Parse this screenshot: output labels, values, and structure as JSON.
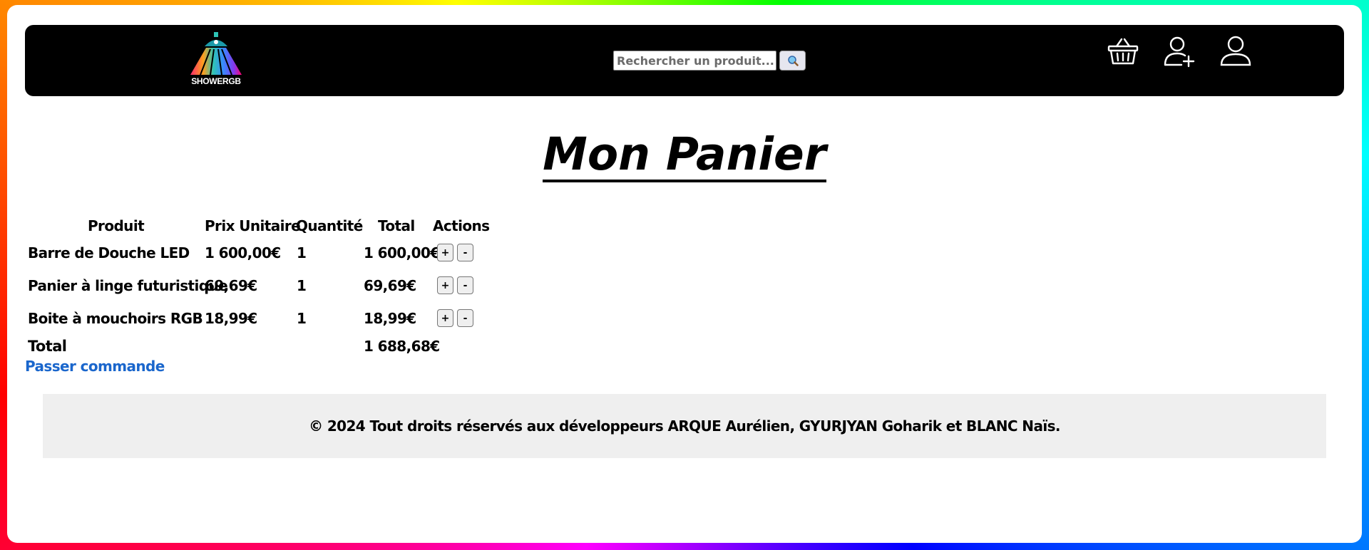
{
  "header": {
    "logo_text": "SHOWERGB",
    "search": {
      "placeholder": "Rechercher un produit..."
    },
    "icons": [
      "search-icon",
      "basket-icon",
      "add-user-icon",
      "user-icon"
    ]
  },
  "page_title": "Mon Panier",
  "cart": {
    "columns": [
      "Produit",
      "Prix Unitaire",
      "Quantité",
      "Total",
      "Actions"
    ],
    "rows": [
      {
        "product": "Barre de Douche LED",
        "unit_price": "1 600,00€",
        "quantity": "1",
        "total": "1 600,00€",
        "plus": "+",
        "minus": "-"
      },
      {
        "product": "Panier à linge futuristique",
        "unit_price": "69,69€",
        "quantity": "1",
        "total": "69,69€",
        "plus": "+",
        "minus": "-"
      },
      {
        "product": "Boite à mouchoirs RGB",
        "unit_price": "18,99€",
        "quantity": "1",
        "total": "18,99€",
        "plus": "+",
        "minus": "-"
      }
    ],
    "total_label": "Total",
    "total_value": "1 688,68€"
  },
  "checkout_link": "Passer commande",
  "footer": {
    "text": "© 2024 Tout droits réservés aux développeurs ARQUE Aurélien, GYURJYAN Goharik et BLANC Naïs."
  },
  "colors": {
    "header_bg": "#000000",
    "link": "#1a66cc",
    "footer_bg": "#efefef"
  }
}
